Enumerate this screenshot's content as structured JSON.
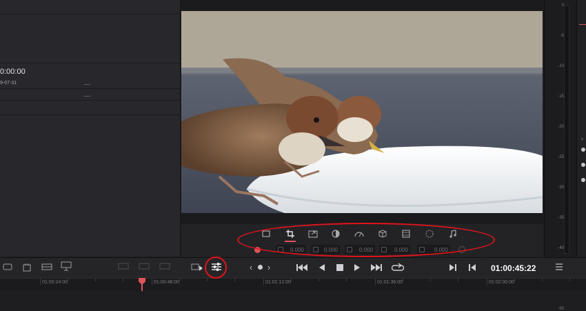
{
  "left_panel": {
    "timecode": "0:00:00",
    "date": "9-07-31",
    "dash1": "__",
    "dash2": "__"
  },
  "viewer": {
    "image_alt": "Two sparrows perched on the rim of a white bowl"
  },
  "inspector_tools": [
    {
      "name": "transform-icon",
      "active": false
    },
    {
      "name": "crop-icon",
      "active": true
    },
    {
      "name": "dynamic-zoom-icon",
      "active": false
    },
    {
      "name": "composite-icon",
      "active": false
    },
    {
      "name": "speed-icon",
      "active": false
    },
    {
      "name": "stabilization-icon",
      "active": false
    },
    {
      "name": "lens-correction-icon",
      "active": false
    },
    {
      "name": "retime-icon",
      "active": false
    },
    {
      "name": "audio-icon",
      "active": false
    }
  ],
  "crop_fields": {
    "left": "0.000",
    "right": "0.000",
    "top": "0.000",
    "bottom": "0.000",
    "softness": "0.000"
  },
  "transport": {
    "timecode": "01:00:45:22",
    "prev_label": "‹",
    "next_label": "›"
  },
  "meters": {
    "ticks": [
      "0",
      "-5",
      "-10",
      "-15",
      "-20",
      "-25",
      "-30",
      "-35",
      "-40",
      "-45",
      "-50"
    ]
  },
  "ruler": {
    "labels": [
      "01:00:24:00",
      "01:00:48:00",
      "01:01:12:00",
      "01:01:36:00",
      "01:02:00:00"
    ],
    "playhead_color": "#e0535b"
  },
  "annotation_color": "#e0141c"
}
